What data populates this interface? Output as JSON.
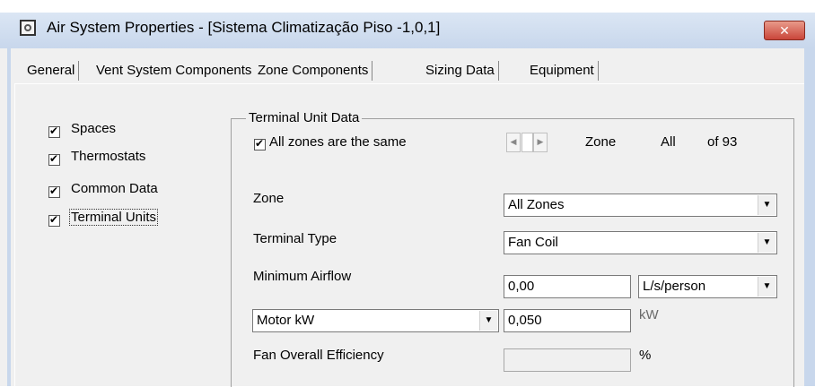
{
  "window": {
    "title": "Air System Properties - [Sistema Climatização Piso -1,0,1]",
    "close_label": "✕"
  },
  "tabs": [
    {
      "label": "General",
      "selected": false
    },
    {
      "label": "Vent System Components",
      "selected": false
    },
    {
      "label": "Zone Components",
      "selected": true
    },
    {
      "label": "Sizing Data",
      "selected": false
    },
    {
      "label": "Equipment",
      "selected": false
    }
  ],
  "sidebar": {
    "items": [
      {
        "label": "Spaces",
        "checked": true
      },
      {
        "label": "Thermostats",
        "checked": true
      },
      {
        "label": "Common Data",
        "checked": true
      },
      {
        "label": "Terminal Units",
        "checked": true,
        "focused": true
      }
    ]
  },
  "terminal_unit": {
    "group_title": "Terminal Unit Data",
    "all_same_label": "All zones are the same",
    "all_same_checked": true,
    "zone_nav": {
      "zone_label": "Zone",
      "zone_value": "All",
      "of_text": "of 93"
    },
    "zone": {
      "label": "Zone",
      "value": "All Zones"
    },
    "terminal_type": {
      "label": "Terminal Type",
      "value": "Fan Coil"
    },
    "minimum_airflow": {
      "label": "Minimum Airflow",
      "value": "0,00",
      "unit": "L/s/person"
    },
    "motor": {
      "selector": "Motor kW",
      "value": "0,050",
      "unit": "kW"
    },
    "fan_efficiency": {
      "label": "Fan Overall Efficiency",
      "value": "",
      "unit": "%"
    }
  },
  "colors": {
    "titlebar": "#c8d7ec",
    "close_button": "#c9463a",
    "dialog_bg": "#f0f0f0"
  }
}
